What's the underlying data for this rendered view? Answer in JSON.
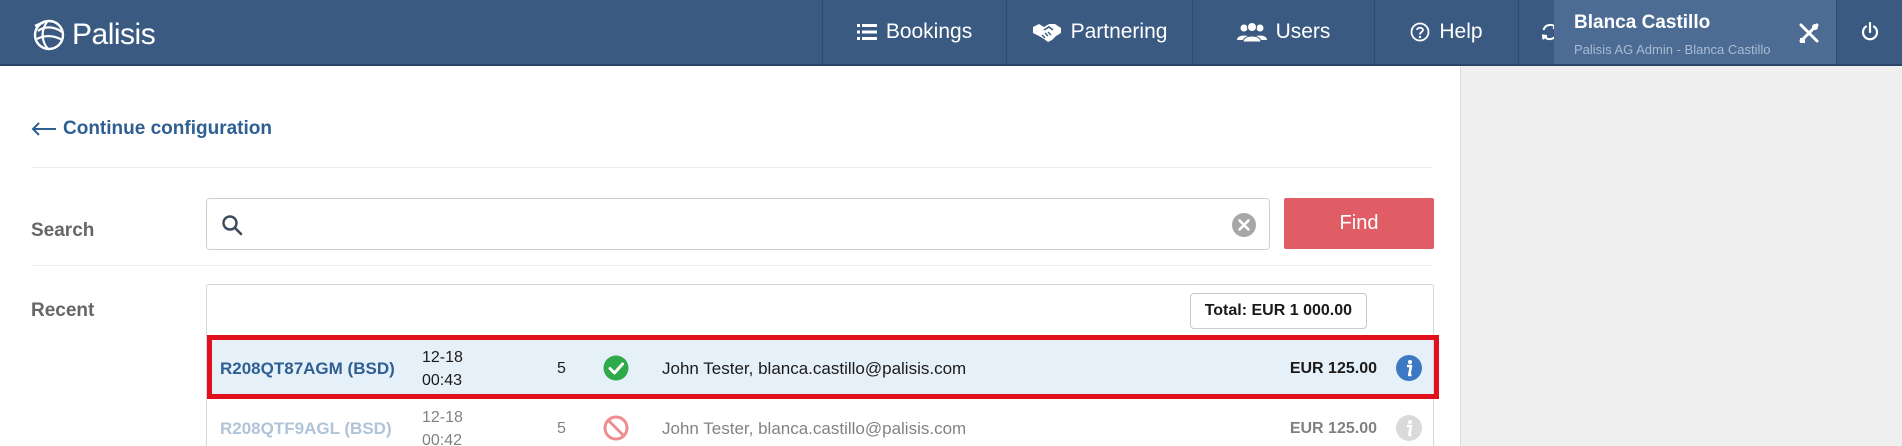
{
  "app": {
    "logo_text": "Palisis"
  },
  "nav": {
    "items": [
      {
        "label": "Bookings",
        "icon": "list-icon"
      },
      {
        "label": "Partnering",
        "icon": "handshake-icon"
      },
      {
        "label": "Users",
        "icon": "users-icon"
      },
      {
        "label": "Help",
        "icon": "help-icon"
      }
    ],
    "refresh_icon": "refresh-icon"
  },
  "user": {
    "name": "Blanca Castillo",
    "role": "Palisis AG Admin - Blanca Castillo",
    "tools_icon": "tools-icon",
    "power_icon": "power-icon"
  },
  "main": {
    "back_link": "Continue configuration",
    "search": {
      "label": "Search",
      "value": "",
      "placeholder": "",
      "find_button": "Find"
    },
    "recent": {
      "label": "Recent",
      "total": "Total: EUR 1 000.00",
      "rows": [
        {
          "ref": "R208QT87AGM (BSD)",
          "date": "12-18",
          "time": "00:43",
          "count": "5",
          "status": "confirmed",
          "name": "John Tester, blanca.castillo@palisis.com",
          "amount": "EUR 125.00"
        },
        {
          "ref": "R208QTF9AGL (BSD)",
          "date": "12-18",
          "time": "00:42",
          "count": "5",
          "status": "cancelled",
          "name": "John Tester, blanca.castillo@palisis.com",
          "amount": "EUR 125.00"
        }
      ]
    }
  },
  "colors": {
    "topbar": "#3a5a82",
    "accent_link": "#2f5f92",
    "find_button": "#e05d66",
    "highlight": "#e0101c",
    "status_ok": "#2eaa4a",
    "status_cancel": "#e0303c"
  }
}
